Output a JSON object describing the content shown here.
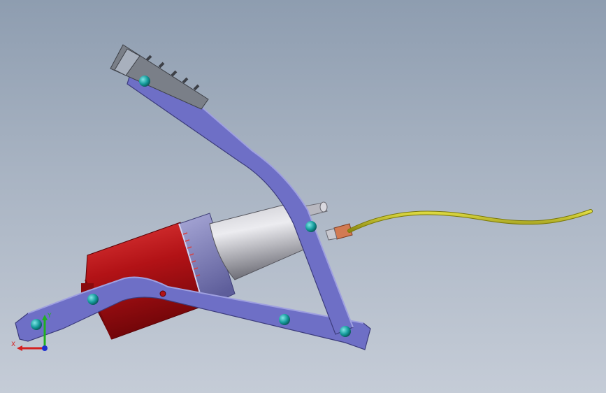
{
  "viewport": {
    "background_top": "#8e9db0",
    "background_bottom": "#c5ccd7"
  },
  "model": {
    "pedal_color": "#6e6fc6",
    "cylinder_color": "#b21216",
    "barrel_color": "#a9a9b0",
    "collar_color": "#8c8cc8",
    "pivot_pin_color": "#1aa6a6",
    "hose_color": "#b9b51a",
    "fitting_color": "#d27a52"
  },
  "triad": {
    "x_label": "X",
    "y_label": "Y",
    "x_color": "#d42020",
    "y_color": "#20b020",
    "z_color": "#2030d0"
  }
}
